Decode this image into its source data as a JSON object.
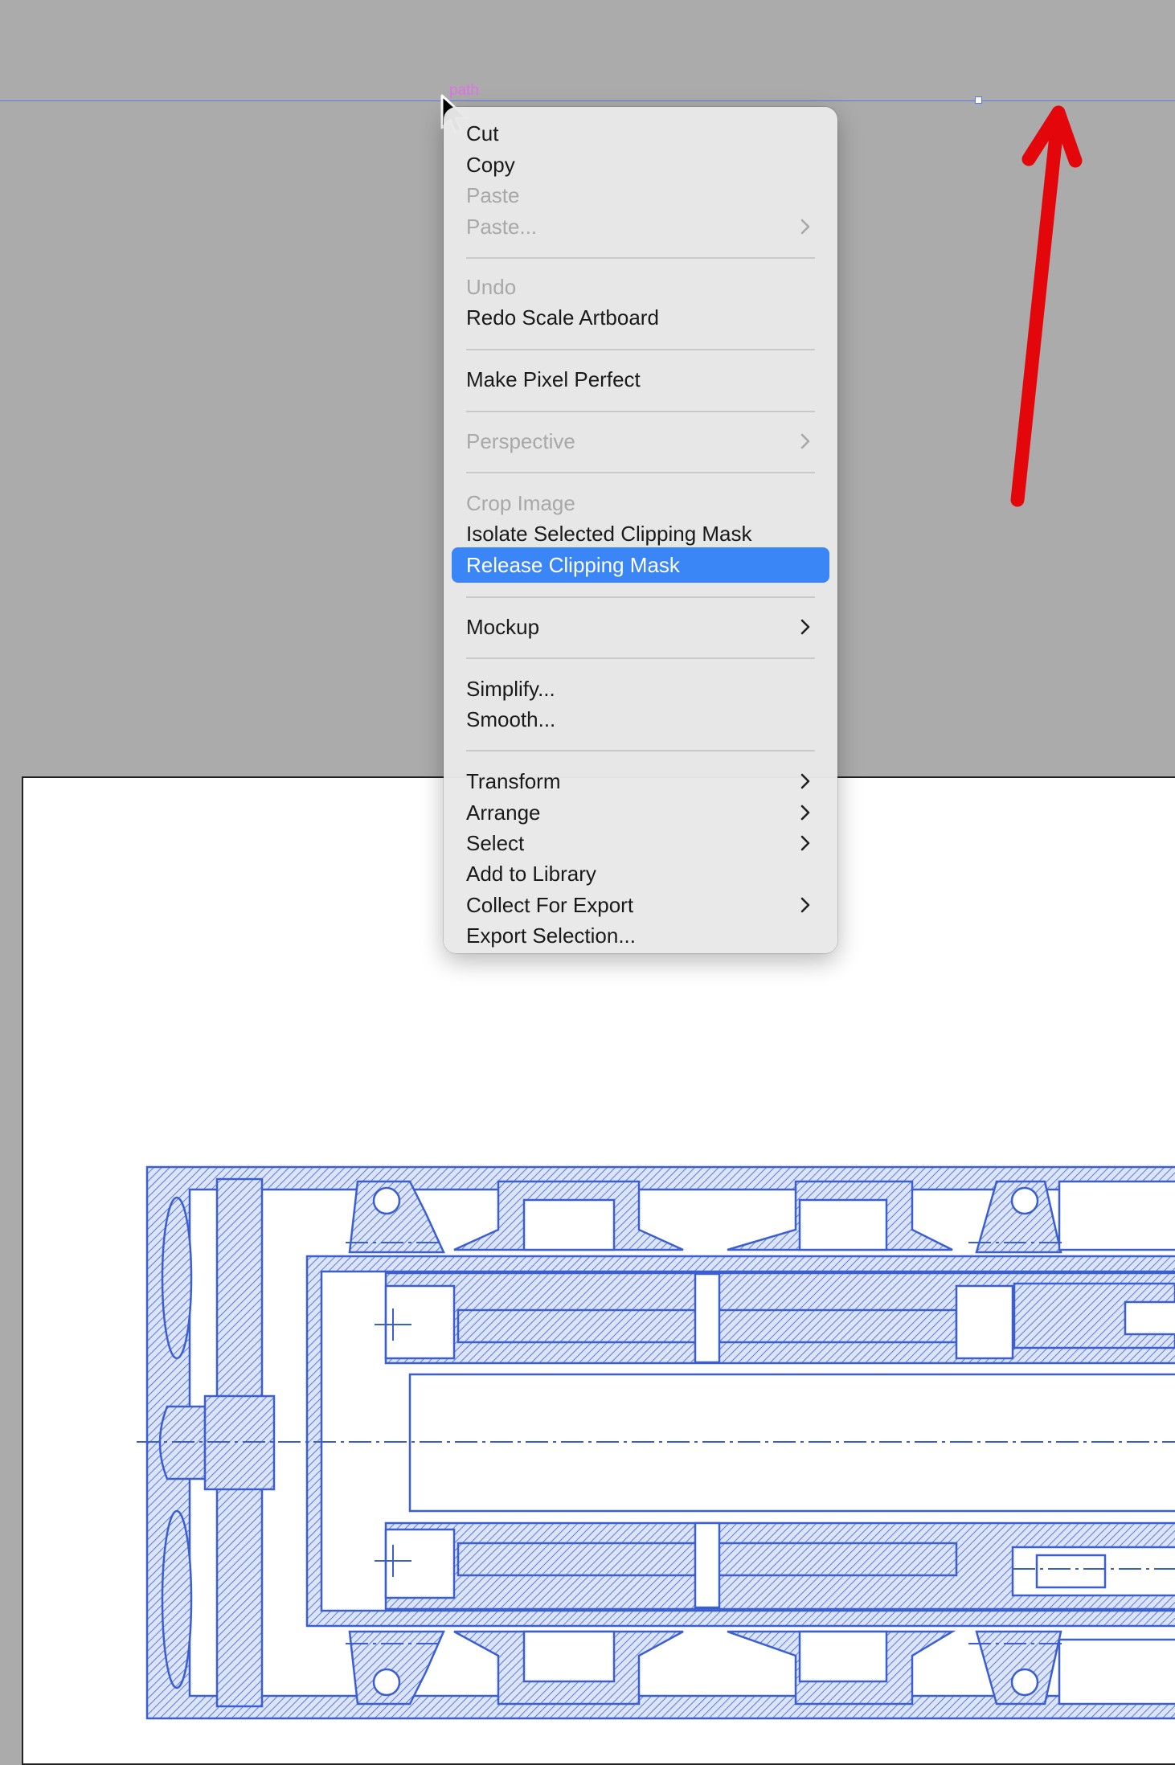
{
  "canvas": {
    "path_label": "path",
    "colors": {
      "pasteboard": "#ababab",
      "artboard": "#ffffff",
      "selection_guide": "#5a78e6",
      "annotation_arrow": "#e3070b",
      "drawing_line": "#3b5fd0"
    }
  },
  "context_menu": {
    "highlight_color": "#3a86f7",
    "items": [
      {
        "label": "Cut",
        "enabled": true,
        "submenu": false
      },
      {
        "label": "Copy",
        "enabled": true,
        "submenu": false
      },
      {
        "label": "Paste",
        "enabled": false,
        "submenu": false
      },
      {
        "label": "Paste...",
        "enabled": false,
        "submenu": true
      },
      {
        "label": "Undo",
        "enabled": false,
        "submenu": false
      },
      {
        "label": "Redo Scale Artboard",
        "enabled": true,
        "submenu": false
      },
      {
        "label": "Make Pixel Perfect",
        "enabled": true,
        "submenu": false
      },
      {
        "label": "Perspective",
        "enabled": false,
        "submenu": true
      },
      {
        "label": "Crop Image",
        "enabled": false,
        "submenu": false
      },
      {
        "label": "Isolate Selected Clipping Mask",
        "enabled": true,
        "submenu": false
      },
      {
        "label": "Release Clipping Mask",
        "enabled": true,
        "submenu": false,
        "highlighted": true
      },
      {
        "label": "Mockup",
        "enabled": true,
        "submenu": true
      },
      {
        "label": "Simplify...",
        "enabled": true,
        "submenu": false
      },
      {
        "label": "Smooth...",
        "enabled": true,
        "submenu": false
      },
      {
        "label": "Transform",
        "enabled": true,
        "submenu": true
      },
      {
        "label": "Arrange",
        "enabled": true,
        "submenu": true
      },
      {
        "label": "Select",
        "enabled": true,
        "submenu": true
      },
      {
        "label": "Add to Library",
        "enabled": true,
        "submenu": false
      },
      {
        "label": "Collect For Export",
        "enabled": true,
        "submenu": true
      },
      {
        "label": "Export Selection...",
        "enabled": true,
        "submenu": false
      }
    ]
  }
}
